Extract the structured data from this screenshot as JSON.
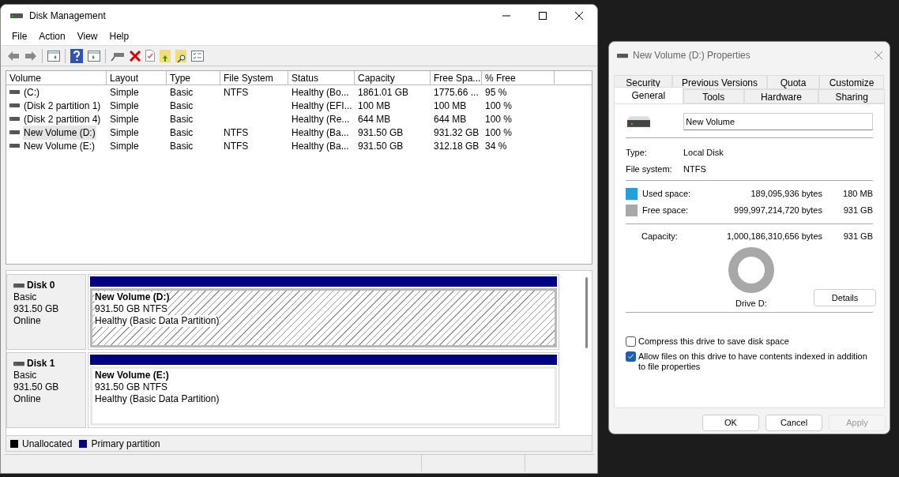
{
  "disk_management": {
    "title": "Disk Management",
    "menu": [
      "File",
      "Action",
      "View",
      "Help"
    ],
    "volume_table": {
      "columns": [
        "Volume",
        "Layout",
        "Type",
        "File System",
        "Status",
        "Capacity",
        "Free Spa...",
        "% Free"
      ],
      "rows": [
        {
          "selected": false,
          "cells": [
            "(C:)",
            "Simple",
            "Basic",
            "NTFS",
            "Healthy (Bo...",
            "1861.01 GB",
            "1775.66 ...",
            "95 %"
          ]
        },
        {
          "selected": false,
          "cells": [
            "(Disk 2 partition 1)",
            "Simple",
            "Basic",
            "",
            "Healthy (EFI...",
            "100 MB",
            "100 MB",
            "100 %"
          ]
        },
        {
          "selected": false,
          "cells": [
            "(Disk 2 partition 4)",
            "Simple",
            "Basic",
            "",
            "Healthy (Re...",
            "644 MB",
            "644 MB",
            "100 %"
          ]
        },
        {
          "selected": true,
          "cells": [
            "New Volume (D:)",
            "Simple",
            "Basic",
            "NTFS",
            "Healthy (Ba...",
            "931.50 GB",
            "931.32 GB",
            "100 %"
          ]
        },
        {
          "selected": false,
          "cells": [
            "New Volume (E:)",
            "Simple",
            "Basic",
            "NTFS",
            "Healthy (Ba...",
            "931.50 GB",
            "312.18 GB",
            "34 %"
          ]
        }
      ]
    },
    "disks": [
      {
        "name": "Disk 0",
        "type": "Basic",
        "size": "931.50 GB",
        "status": "Online",
        "partitions": [
          {
            "name": "New Volume  (D:)",
            "size_fs": "931.50 GB NTFS",
            "status": "Healthy (Basic Data Partition)",
            "selected": true
          }
        ]
      },
      {
        "name": "Disk 1",
        "type": "Basic",
        "size": "931.50 GB",
        "status": "Online",
        "partitions": [
          {
            "name": "New Volume  (E:)",
            "size_fs": "931.50 GB NTFS",
            "status": "Healthy (Basic Data Partition)",
            "selected": false
          }
        ]
      }
    ],
    "legend": [
      {
        "label": "Unallocated",
        "color": "#000000"
      },
      {
        "label": "Primary partition",
        "color": "#000080"
      }
    ]
  },
  "properties": {
    "title": "New Volume (D:) Properties",
    "tab_rows": [
      [
        {
          "label": "Security",
          "selected": false
        },
        {
          "label": "Previous Versions",
          "selected": false
        },
        {
          "label": "Quota",
          "selected": false
        },
        {
          "label": "Customize",
          "selected": false
        }
      ],
      [
        {
          "label": "General",
          "selected": true
        },
        {
          "label": "Tools",
          "selected": false
        },
        {
          "label": "Hardware",
          "selected": false
        },
        {
          "label": "Sharing",
          "selected": false
        }
      ]
    ],
    "name_field": {
      "value": "New Volume"
    },
    "info": [
      {
        "label": "Type:",
        "value": "Local Disk"
      },
      {
        "label": "File system:",
        "value": "NTFS"
      }
    ],
    "space": [
      {
        "label": "Used space:",
        "bytes": "189,095,936 bytes",
        "size": "180 MB",
        "color": "#26a0da"
      },
      {
        "label": "Free space:",
        "bytes": "999,997,214,720 bytes",
        "size": "931 GB",
        "color": "#a8a8a8"
      }
    ],
    "capacity": {
      "label": "Capacity:",
      "bytes": "1,000,186,310,656 bytes",
      "size": "931 GB"
    },
    "drive_label": "Drive D:",
    "details_button": "Details",
    "checkboxes": [
      {
        "label": "Compress this drive to save disk space",
        "checked": false
      },
      {
        "label": "Allow files on this drive to have contents indexed in addition to file properties",
        "checked": true
      }
    ],
    "buttons": [
      {
        "label": "OK",
        "disabled": false
      },
      {
        "label": "Cancel",
        "disabled": false
      },
      {
        "label": "Apply",
        "disabled": true
      }
    ]
  }
}
